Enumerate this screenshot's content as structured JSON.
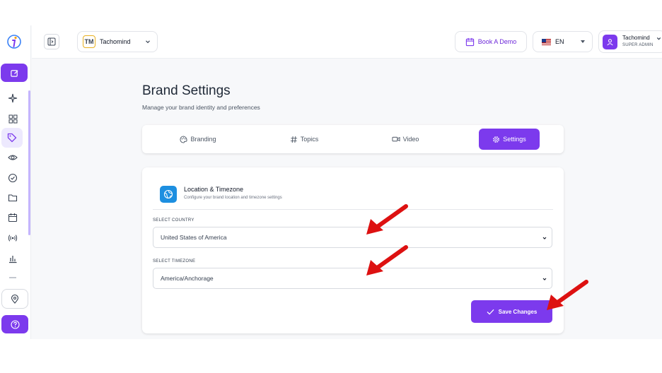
{
  "brand_selector": {
    "badge": "TM",
    "name": "Tachomind"
  },
  "topbar": {
    "book_demo_label": "Book A Demo",
    "language": "EN"
  },
  "user": {
    "name": "Tachomind",
    "role": "SUPER ADMIN"
  },
  "page": {
    "title": "Brand Settings",
    "subtitle": "Manage your brand identity and preferences"
  },
  "tabs": [
    {
      "label": "Branding",
      "icon": "palette-icon"
    },
    {
      "label": "Topics",
      "icon": "hash-icon"
    },
    {
      "label": "Video",
      "icon": "video-icon"
    },
    {
      "label": "Settings",
      "icon": "gear-icon",
      "active": true
    }
  ],
  "location_card": {
    "title": "Location & Timezone",
    "subtitle": "Configure your brand location and timezone settings",
    "country_label": "SELECT COUNTRY",
    "country_value": "United States of America",
    "timezone_label": "SELECT TIMEZONE",
    "timezone_value": "America/Anchorage",
    "save_label": "Save Changes"
  },
  "colors": {
    "accent": "#7c3aed",
    "annotation": "#dd1111",
    "card_icon": "#1d8fe0"
  }
}
